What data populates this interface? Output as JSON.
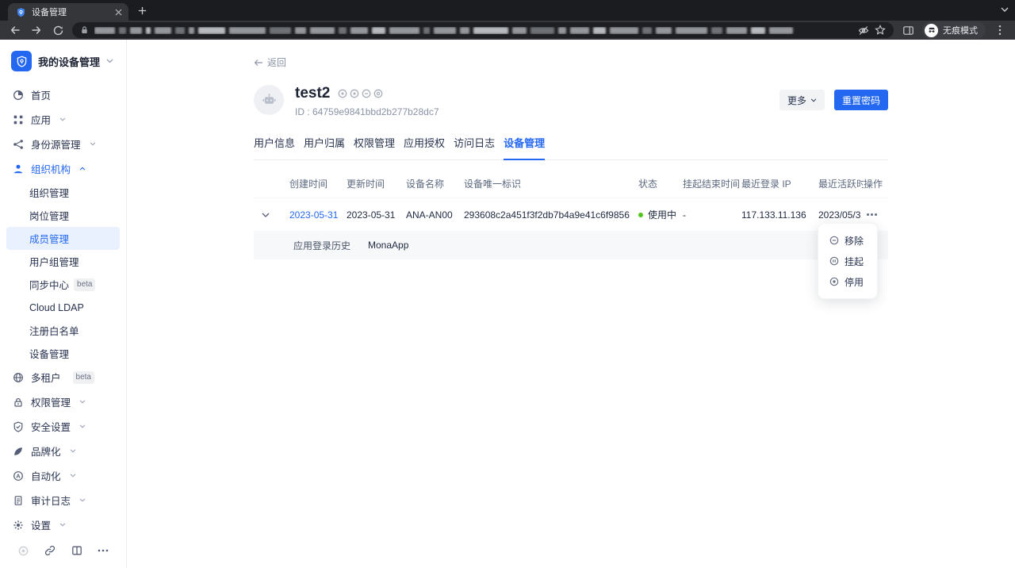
{
  "browser": {
    "tab_title": "设备管理",
    "incognito_label": "无痕模式"
  },
  "sidebar": {
    "workspace_name": "我的设备管理",
    "nav": [
      {
        "label": "首页"
      },
      {
        "label": "应用"
      },
      {
        "label": "身份源管理"
      },
      {
        "label": "组织机构"
      },
      {
        "label": "多租户",
        "badge": "beta"
      },
      {
        "label": "权限管理"
      },
      {
        "label": "安全设置"
      },
      {
        "label": "品牌化"
      },
      {
        "label": "自动化"
      },
      {
        "label": "审计日志"
      },
      {
        "label": "设置"
      }
    ],
    "org_children": [
      {
        "label": "组织管理"
      },
      {
        "label": "岗位管理"
      },
      {
        "label": "成员管理"
      },
      {
        "label": "用户组管理"
      },
      {
        "label": "同步中心",
        "badge": "beta"
      },
      {
        "label": "Cloud LDAP"
      },
      {
        "label": "注册白名单"
      },
      {
        "label": "设备管理"
      }
    ]
  },
  "page": {
    "back_label": "返回",
    "user_name": "test2",
    "user_id": "ID : 64759e9841bbd2b277b28dc7",
    "more_button": "更多",
    "reset_password_button": "重置密码",
    "tabs": [
      {
        "label": "用户信息"
      },
      {
        "label": "用户归属"
      },
      {
        "label": "权限管理"
      },
      {
        "label": "应用授权"
      },
      {
        "label": "访问日志"
      },
      {
        "label": "设备管理"
      }
    ]
  },
  "device_table": {
    "columns": [
      "创建时间",
      "更新时间",
      "设备名称",
      "设备唯一标识",
      "状态",
      "挂起结束时间",
      "最近登录 IP",
      "最近活跃时",
      "操作"
    ],
    "row": {
      "created": "2023-05-31",
      "updated": "2023-05-31",
      "device_name": "ANA-AN00",
      "device_uid": "293608c2a451f3f2db7b4a9e41c6f9856",
      "status": "使用中",
      "suspend_end_time": "-",
      "last_login_ip": "117.133.11.136",
      "last_active": "2023/05/3"
    },
    "expanded_row": {
      "label": "应用登录历史",
      "value": "MonaApp"
    }
  },
  "context_menu": {
    "items": [
      {
        "label": "移除",
        "icon": "minus-circle-icon"
      },
      {
        "label": "挂起",
        "icon": "pause-circle-icon"
      },
      {
        "label": "停用",
        "icon": "stop-circle-icon"
      }
    ]
  },
  "colors": {
    "primary": "#2468f2",
    "selected_nav_bg": "#e9f1fe",
    "status_active_green": "#52c41a",
    "chrome_dark": "#1b1c1f"
  }
}
